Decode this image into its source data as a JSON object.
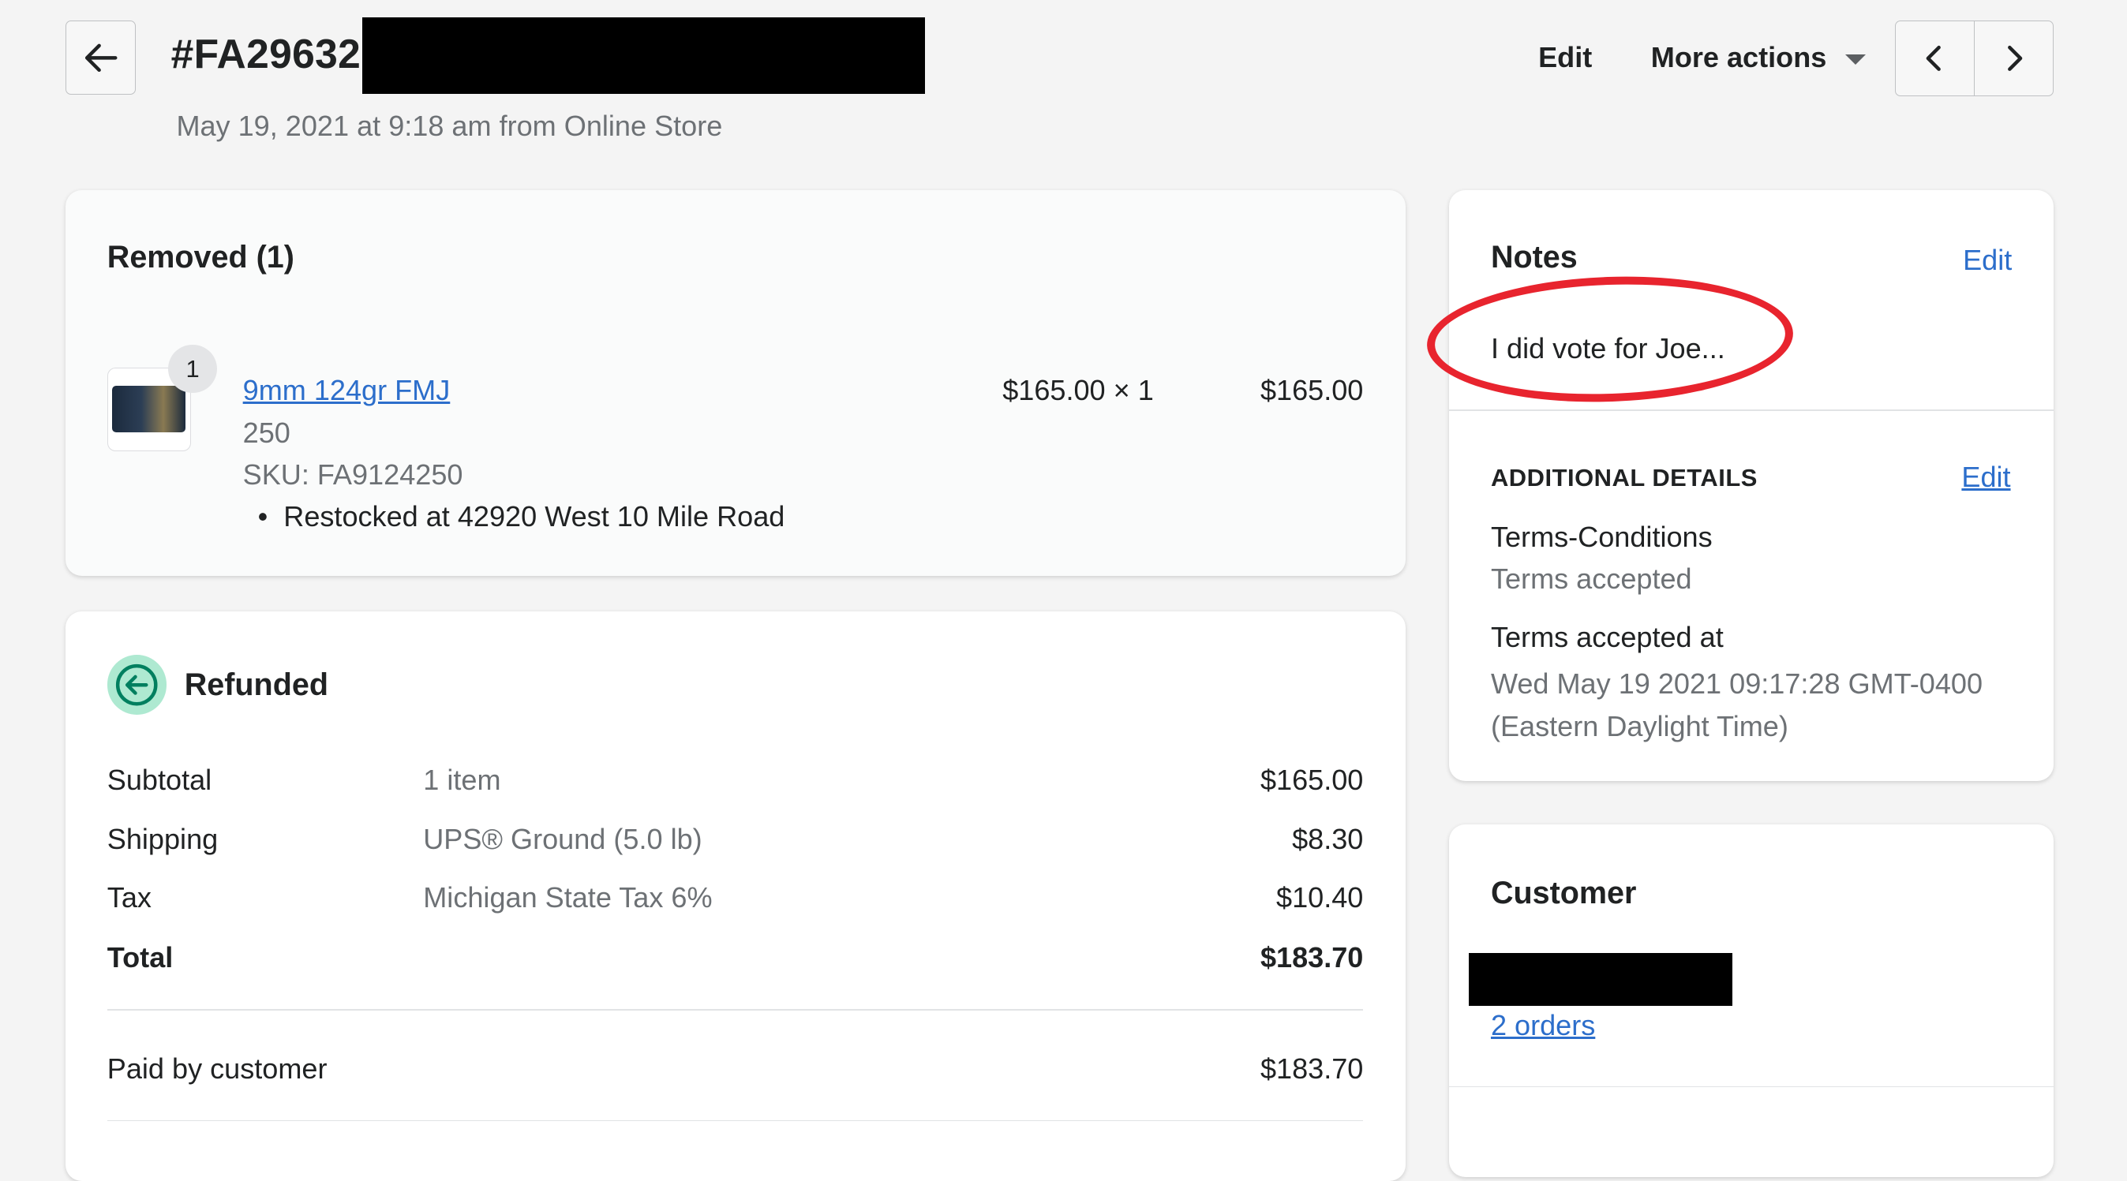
{
  "header": {
    "order_number": "#FA29632",
    "subtitle": "May 19, 2021 at 9:18 am from Online Store",
    "edit_label": "Edit",
    "more_actions_label": "More actions",
    "icons": {
      "back": "arrow-left-icon",
      "prev": "chevron-left-icon",
      "next": "chevron-right-icon"
    }
  },
  "removed": {
    "title": "Removed (1)",
    "item": {
      "quantity_badge": "1",
      "name": "9mm 124gr FMJ",
      "variant": "250",
      "sku": "SKU: FA9124250",
      "restock_note": "Restocked at 42920 West 10 Mile Road",
      "unit_price_qty": "$165.00 × 1",
      "line_total": "$165.00"
    }
  },
  "refunded": {
    "title": "Refunded",
    "rows": [
      {
        "label": "Subtotal",
        "detail": "1 item",
        "amount": "$165.00"
      },
      {
        "label": "Shipping",
        "detail": "UPS® Ground (5.0 lb)",
        "amount": "$8.30"
      },
      {
        "label": "Tax",
        "detail": "Michigan State Tax 6%",
        "amount": "$10.40"
      }
    ],
    "total_label": "Total",
    "total_amount": "$183.70",
    "paid_label": "Paid by customer",
    "paid_amount": "$183.70"
  },
  "notes": {
    "title": "Notes",
    "edit_label": "Edit",
    "text": "I did vote for Joe...",
    "additional_title": "ADDITIONAL DETAILS",
    "additional_edit_label": "Edit",
    "details": [
      {
        "key": "Terms-Conditions",
        "value": "Terms accepted"
      },
      {
        "key": "Terms accepted at",
        "value": "Wed May 19 2021 09:17:28 GMT-0400 (Eastern Daylight Time)"
      }
    ]
  },
  "customer": {
    "title": "Customer",
    "orders_link": "2 orders"
  },
  "colors": {
    "link": "#2c6ecb",
    "annotation_circle": "#e8242e",
    "refund_icon_bg": "#aee9d1"
  }
}
